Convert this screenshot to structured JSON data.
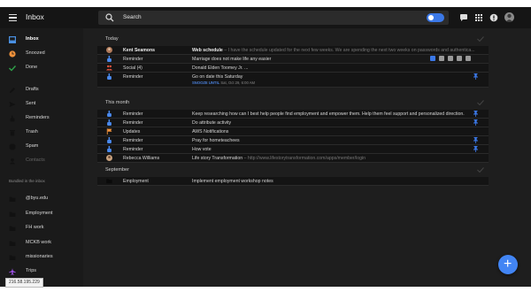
{
  "app": {
    "title": "Inbox"
  },
  "search": {
    "placeholder": "Search"
  },
  "sidebar": {
    "items": [
      {
        "label": "Inbox",
        "icon": "inbox-icon",
        "color": "#4a90e2"
      },
      {
        "label": "Snoozed",
        "icon": "clock-icon",
        "color": "#f0923b"
      },
      {
        "label": "Done",
        "icon": "check-icon",
        "color": "#2fa34a"
      },
      {
        "label": "Drafts",
        "icon": "draft-icon"
      },
      {
        "label": "Sent",
        "icon": "send-icon"
      },
      {
        "label": "Reminders",
        "icon": "reminder-finger-icon"
      },
      {
        "label": "Trash",
        "icon": "trash-icon"
      },
      {
        "label": "Spam",
        "icon": "spam-icon"
      },
      {
        "label": "Contacts",
        "icon": "contacts-icon"
      }
    ],
    "bundled_header": "Bundled in the inbox",
    "bundles": [
      {
        "label": "@byu.edu",
        "icon": "folder-icon"
      },
      {
        "label": "Employment",
        "icon": "folder-icon"
      },
      {
        "label": "FH work",
        "icon": "folder-icon"
      },
      {
        "label": "MCKB work",
        "icon": "folder-icon"
      },
      {
        "label": "missionaries",
        "icon": "folder-icon"
      },
      {
        "label": "Trips",
        "icon": "plane-icon",
        "color": "#a855f7"
      }
    ]
  },
  "sections": {
    "today": {
      "title": "Today",
      "rows": [
        {
          "sender": "Kent Seamons",
          "subject": "Web schedule",
          "snippet": " – I have the schedule updated for the next few weeks. We are spending the next two weeks on passwords and authentica..."
        },
        {
          "sender": "Reminder",
          "subject": "Marriage does not make life any easier"
        },
        {
          "sender": "Social (4)",
          "subject": "Donald Elden Toomey Jr. ..."
        },
        {
          "sender": "Reminder",
          "subject": "Go on date this Saturday",
          "snooze_tag": "SNOOZE UNTIL",
          "snooze_time": "Sat, Oct 29, 6:00 AM"
        }
      ]
    },
    "this_month": {
      "title": "This month",
      "rows": [
        {
          "sender": "Reminder",
          "subject": "Keep researching how can I best help people find employment and empower them. Help them feel support and personalized direction."
        },
        {
          "sender": "Reminder",
          "subject": "Do attribute activity"
        },
        {
          "sender": "Updates",
          "subject": "AWS Notifications"
        },
        {
          "sender": "Reminder",
          "subject": "Pray for hometeachees"
        },
        {
          "sender": "Reminder",
          "subject": "How vote"
        },
        {
          "sender": "Rebecca Williams",
          "subject": "Life story Transformation",
          "snippet": " – http://www.lifestorytransformation.com/apps/member/login"
        }
      ]
    },
    "september": {
      "title": "September",
      "rows": [
        {
          "sender": "Employment",
          "subject": "Implement employment workshop notes"
        }
      ]
    }
  },
  "status": {
    "ip": "216.58.195.229"
  },
  "colors": {
    "accent": "#4285f4",
    "pin": "#3b78e7",
    "background": "#1e1e1e"
  }
}
